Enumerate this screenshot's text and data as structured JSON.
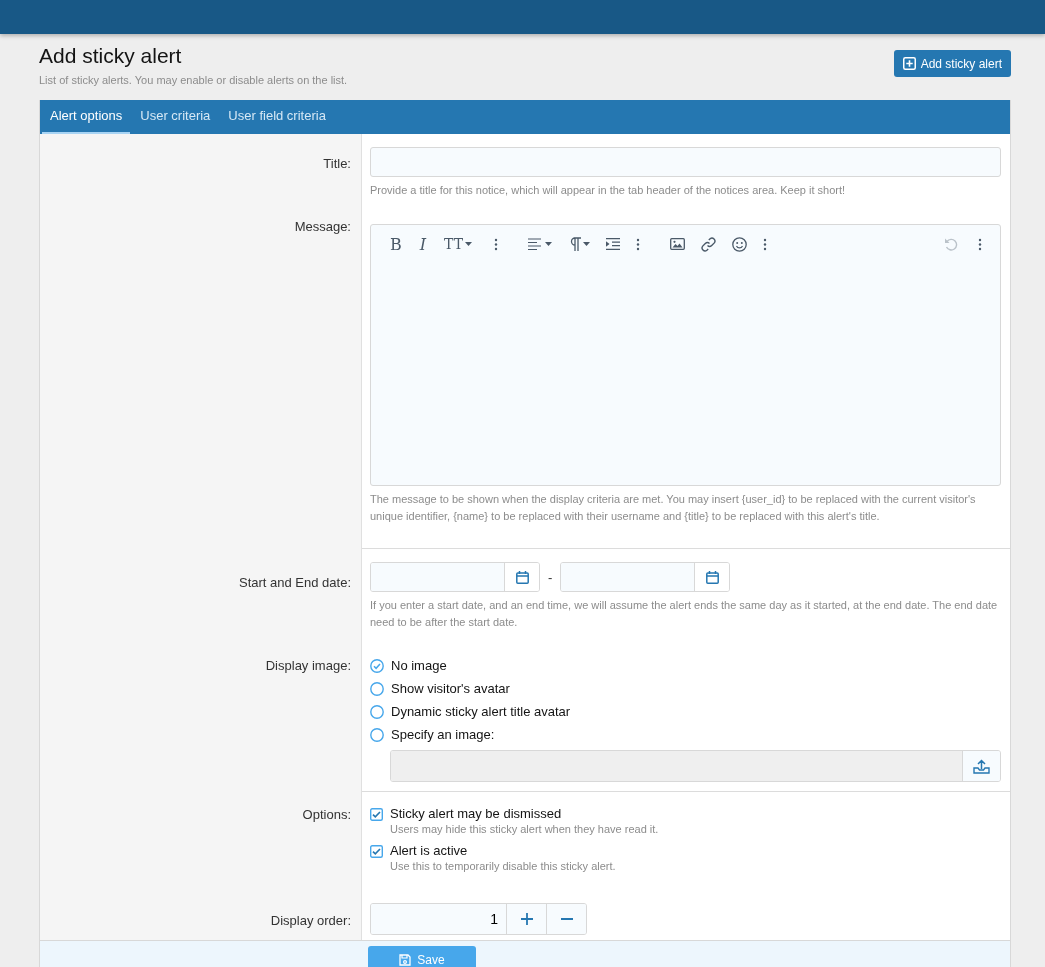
{
  "page": {
    "title": "Add sticky alert",
    "description": "List of sticky alerts. You may enable or disable alerts on the list.",
    "action_button": "Add sticky alert"
  },
  "tabs": [
    {
      "label": "Alert options",
      "selected": true
    },
    {
      "label": "User criteria",
      "selected": false
    },
    {
      "label": "User field criteria",
      "selected": false
    }
  ],
  "form": {
    "title": {
      "label": "Title:",
      "hint": "Provide a title for this notice, which will appear in the tab header of the notices area. Keep it short!"
    },
    "message": {
      "label": "Message:",
      "toolbar": [
        {
          "kind": "bold",
          "label": "B",
          "disabled": false
        },
        {
          "kind": "italic",
          "label": "I",
          "disabled": false
        },
        {
          "kind": "size",
          "label": "TT",
          "disabled": false
        },
        {
          "kind": "more",
          "disabled": false
        },
        {
          "kind": "align",
          "disabled": false
        },
        {
          "kind": "paragraph",
          "disabled": false
        },
        {
          "kind": "indent",
          "disabled": false
        },
        {
          "kind": "more",
          "disabled": false
        },
        {
          "kind": "image",
          "disabled": false
        },
        {
          "kind": "link",
          "disabled": false
        },
        {
          "kind": "smilie",
          "disabled": false
        },
        {
          "kind": "more",
          "disabled": false
        },
        {
          "kind": "undo",
          "disabled": true
        },
        {
          "kind": "more",
          "disabled": false
        }
      ],
      "hint": "The message to be shown when the display criteria are met. You may insert {user_id} to be replaced with the current visitor's unique identifier, {name} to be replaced with their username and {title} to be replaced with this alert's title."
    },
    "dates": {
      "label": "Start and End date:",
      "separator": "-",
      "hint": "If you enter a start date, and an end time, we will assume the alert ends the same day as it started, at the end date. The end date need to be after the start date."
    },
    "display_image": {
      "label": "Display image:",
      "options": [
        {
          "label": "No image",
          "selected": true
        },
        {
          "label": "Show visitor's avatar",
          "selected": false
        },
        {
          "label": "Dynamic sticky alert title avatar",
          "selected": false
        },
        {
          "label": "Specify an image:",
          "selected": false
        }
      ]
    },
    "options": {
      "label": "Options:",
      "items": [
        {
          "label": "Sticky alert may be dismissed",
          "hint": "Users may hide this sticky alert when they have read it.",
          "checked": true
        },
        {
          "label": "Alert is active",
          "hint": "Use this to temporarily disable this sticky alert.",
          "checked": true
        }
      ]
    },
    "display_order": {
      "label": "Display order:",
      "value": "1"
    },
    "save_button": "Save"
  }
}
